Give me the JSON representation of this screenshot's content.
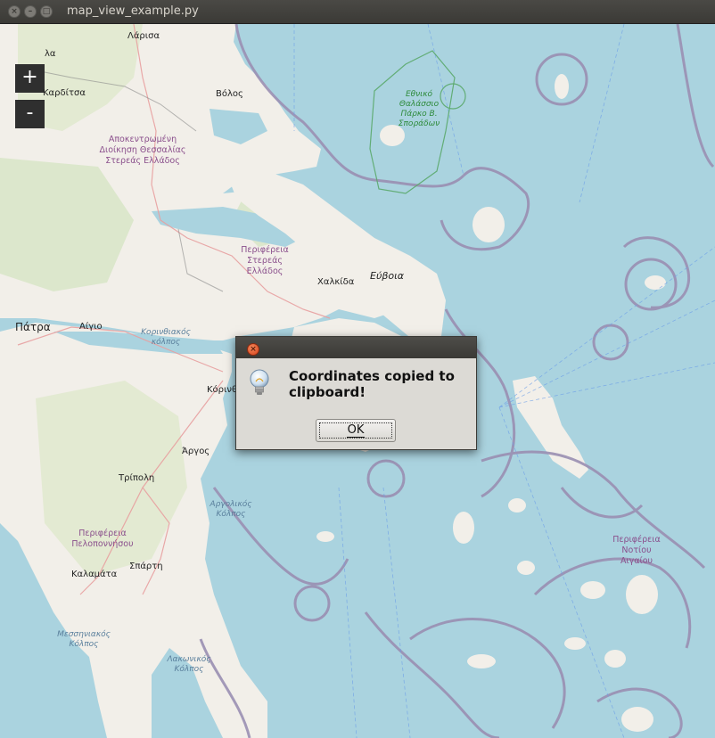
{
  "window": {
    "title": "map_view_example.py",
    "buttons": [
      "close-icon",
      "minimize-icon",
      "maximize-icon"
    ]
  },
  "map": {
    "zoom_in_label": "+",
    "zoom_out_label": "-",
    "labels": {
      "larisa": "Λάρισα",
      "la": "λα",
      "karditsa": "Καρδίτσα",
      "volos": "Βόλος",
      "region_thessaly": "Αποκεντρωμένη Διοίκηση Θεσσαλίας Στερεάς Ελλάδος",
      "park": "Εθνικό Θαλάσσιο Πάρκο Β. Σποράδων",
      "region_sterea": "Περιφέρεια Στερεάς Ελλάδος",
      "evia": "Εύβοια",
      "chalkida": "Χαλκίδα",
      "patra": "Πάτρα",
      "aigio": "Αίγιο",
      "corinth_gulf": "Κορινθιακός κόλπος",
      "korinthos": "Κόρινθ",
      "argos": "Άργος",
      "tripoli": "Τρίπολη",
      "argolic_gulf": "Αργολικός Κόλπος",
      "region_peloponnese": "Περιφέρεια Πελοποννήσου",
      "sparti": "Σπάρτη",
      "kalamata": "Καλαμάτα",
      "messiniakos": "Μεσσηνιακός Κόλπος",
      "lakonikos": "Λακωνικός Κόλπος",
      "region_south_aegean": "Περιφέρεια Νοτίου Αιγαίου"
    }
  },
  "dialog": {
    "icon": "lightbulb-icon",
    "message": "Coordinates copied to clipboard!",
    "ok_label": "OK"
  },
  "colors": {
    "sea": "#aad3df",
    "land": "#f2efe9",
    "boundary": "#9e8fb0",
    "titlebar": "#3c3b37"
  }
}
